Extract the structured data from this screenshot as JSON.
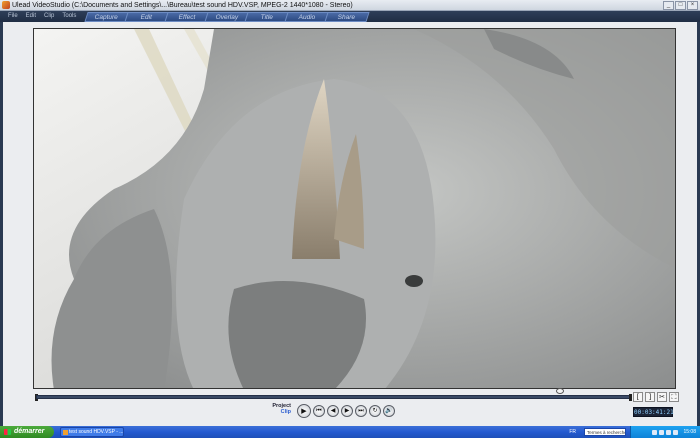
{
  "window": {
    "title": "Ulead VideoStudio (C:\\Documents and Settings\\...\\Bureau\\test sound HDV.VSP, MPEG-2 1440*1080 - Stereo)",
    "controls": [
      "_",
      "□",
      "×"
    ]
  },
  "menu": [
    "File",
    "Edit",
    "Clip",
    "Tools"
  ],
  "steps": [
    "Capture",
    "Edit",
    "Effect",
    "Overlay",
    "Title",
    "Audio",
    "Share"
  ],
  "player": {
    "mode_project": "Project",
    "mode_clip": "Clip",
    "timecode": "00:03:41:21",
    "trim": [
      "[",
      "]",
      "✂",
      "⛶"
    ],
    "controls": [
      "▶",
      "⏮",
      "◀",
      "▶",
      "⏭",
      "↻",
      "🔊"
    ]
  },
  "taskbar": {
    "start_label": "démarrer",
    "task_label": "test sound HDV.VSP - ...",
    "lang": "FR",
    "search_placeholder": "Termes à rechercher",
    "clock": "15:08"
  },
  "colors": {
    "accent_tabs": "#2c4a82",
    "taskbar": "#245ad0",
    "start": "#2f8a22"
  }
}
